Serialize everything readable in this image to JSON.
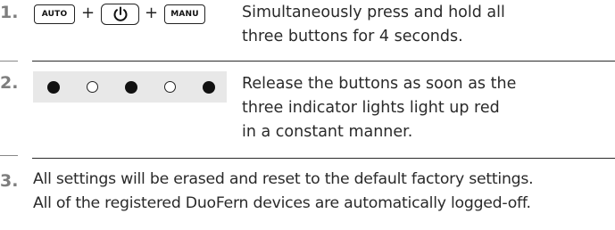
{
  "steps": [
    {
      "number": "1.",
      "buttons": {
        "auto": "AUTO",
        "manu": "MANU",
        "plus": "+"
      },
      "lines": [
        "Simultaneously press and hold all",
        "three buttons for 4 seconds."
      ]
    },
    {
      "number": "2.",
      "leds": [
        "on",
        "off",
        "on",
        "off",
        "on"
      ],
      "lines": [
        "Release the buttons as soon as the",
        "three indicator lights light up red",
        "in a constant manner."
      ]
    },
    {
      "number": "3.",
      "lines": [
        "All settings will be erased and reset to the default factory settings.",
        "All of the registered DuoFern devices are automatically logged-off."
      ]
    }
  ],
  "icons": {
    "power": "power-icon"
  },
  "colors": {
    "step_number": "#7e7e7e",
    "led_band": "#e8e8e8"
  }
}
